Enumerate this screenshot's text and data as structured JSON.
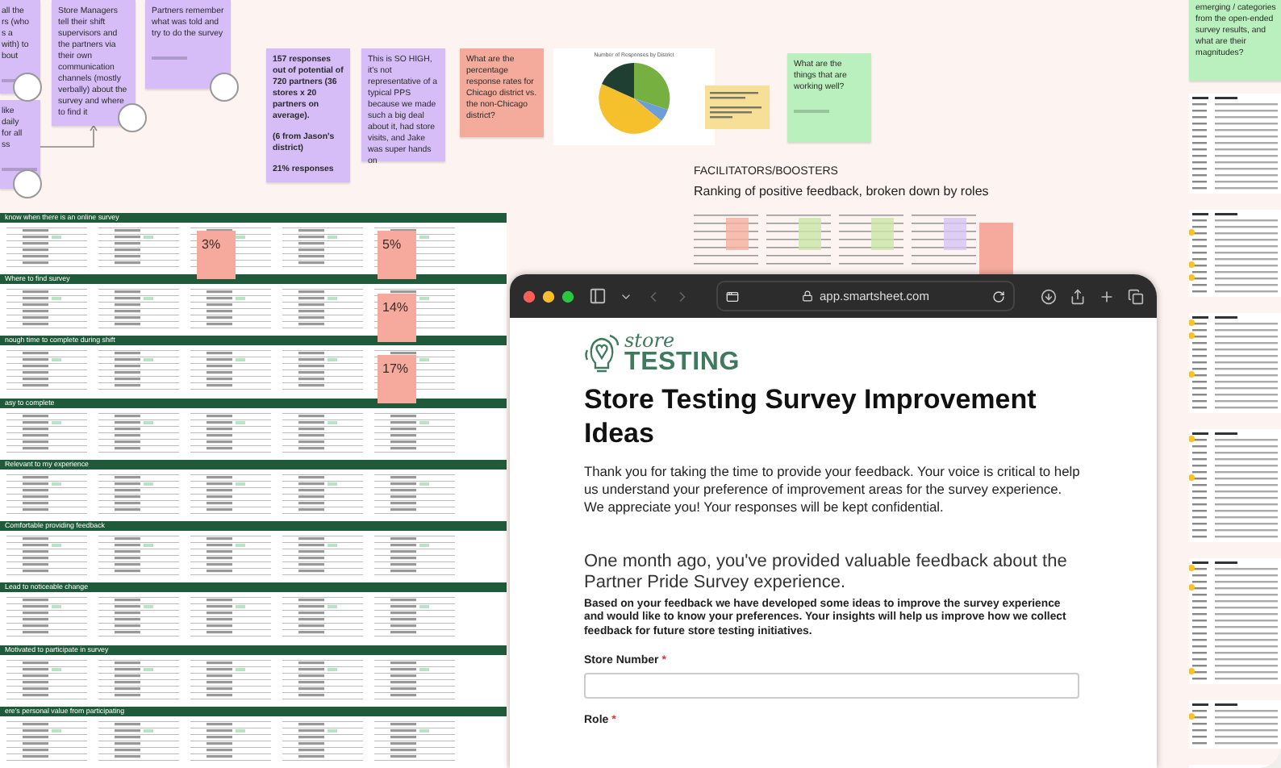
{
  "board": {
    "stickies": [
      {
        "color": "#d6bdf7",
        "bold": false,
        "paragraphs": [
          "all the\nrs (who\ns a\nwith) to\nbout"
        ]
      },
      {
        "color": "#d6bdf7",
        "bold": false,
        "paragraphs": [
          "like\ndaily\nfor all\nss"
        ]
      },
      {
        "color": "#d6bdf7",
        "bold": false,
        "paragraphs": [
          "Store Managers tell their shift supervisors and the partners via their own communication channels (mostly verbally) about the survey and where to find it"
        ]
      },
      {
        "color": "#d6bdf7",
        "bold": false,
        "paragraphs": [
          "Partners remember what was told and try to do the survey"
        ]
      },
      {
        "color": "#d6bdf7",
        "bold": true,
        "paragraphs": [
          "157 responses out of potential of 720 partners (36 stores x 20 partners on average).",
          "(6 from Jason's district)",
          "21% responses"
        ]
      },
      {
        "color": "#d6bdf7",
        "bold": false,
        "paragraphs": [
          "This is SO HIGH, it's not representative of a typical PPS because we made such a big deal about it, had store visits, and Jake was super hands on"
        ]
      },
      {
        "color": "#f4ab9c",
        "bold": false,
        "paragraphs": [
          "What are the percentage response rates for Chicago district vs. the non-Chicago district?"
        ]
      },
      {
        "color": "#b9f0bd",
        "bold": false,
        "paragraphs": [
          "What are the things that are working well?"
        ]
      },
      {
        "color": "#b9f0bd",
        "bold": false,
        "paragraphs": [
          "emerging / categories from the open-ended survey results, and what are their magnitudes?"
        ]
      }
    ],
    "percent_notes": [
      "3%",
      "5%",
      "14%",
      "17%"
    ],
    "chart": {
      "title": "Number of Responses by District"
    },
    "section": {
      "heading": "FACILITATORS/BOOSTERS",
      "subheading": "Ranking of positive feedback, broken down by roles"
    },
    "spreadsheet": {
      "sections": [
        "know when there is an online survey",
        "Where to find survey",
        "nough time to complete during shift",
        "asy to complete",
        "Relevant to my experience",
        "Comfortable providing feedback",
        "Lead to noticeable change",
        "Motivated to participate in survey",
        "ere's personal value from participating"
      ]
    }
  },
  "browser": {
    "url": "app.smartsheet.com",
    "logo": {
      "top": "store",
      "bottom": "TESTING"
    },
    "title": "Store Testing Survey Improvement Ideas",
    "intro": "Thank you for taking the time to provide your feedback. Your voice is critical to help us understand your preference of improvement areas for the survey experience. We appreciate you! Your responses will be kept confidential.",
    "subheading": "One month ago, you've provided valuable feedback about the Partner Pride Survey experience.",
    "description": "Based on your feedback we have developed some ideas to improve the survey experience and would like to know your preferences. Your insights will help us improve how we collect feedback for future store testing initiatives.",
    "fields": [
      {
        "label": "Store Number",
        "required_mark": "*",
        "kind": "text"
      },
      {
        "label": "Role",
        "required_mark": "*",
        "kind": "cut"
      }
    ]
  }
}
